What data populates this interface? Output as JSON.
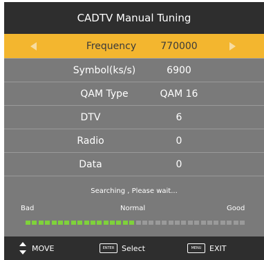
{
  "title": "CADTV Manual Tuning",
  "rows": [
    {
      "label": "Frequency",
      "value": "770000"
    },
    {
      "label": "Symbol(ks/s)",
      "value": "6900"
    },
    {
      "label": "QAM Type",
      "value": "QAM 16"
    },
    {
      "label": "DTV",
      "value": "6"
    },
    {
      "label": "Radio",
      "value": "0"
    },
    {
      "label": "Data",
      "value": "0"
    }
  ],
  "status": "Searching , Please wait...",
  "meter": {
    "bad_label": "Bad",
    "normal_label": "Normal",
    "good_label": "Good",
    "level_segments": 17,
    "total_segments": 34
  },
  "footer": {
    "move_label": "MOVE",
    "select_key": "ENTER",
    "select_label": "Select",
    "exit_key": "MENU",
    "exit_label": "EXIT"
  },
  "colors": {
    "highlight": "#f3b62f",
    "meter_on": "#7fd23b",
    "meter_off": "#9a9a9a",
    "panel": "#7a7a7a",
    "bar": "#2e2e2e"
  }
}
